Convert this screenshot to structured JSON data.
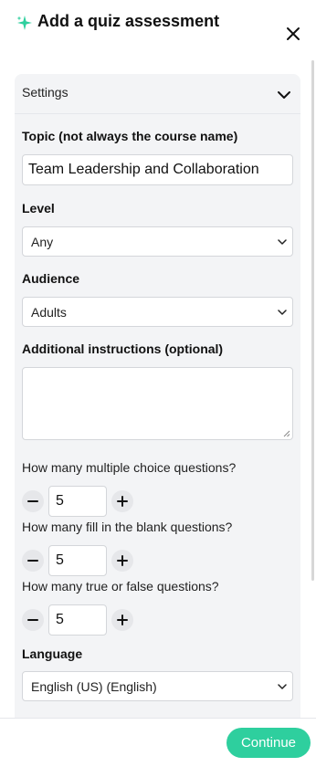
{
  "header": {
    "title": "Add a quiz assessment",
    "sparkle_icon": "sparkle-icon",
    "close_icon": "close-icon",
    "accent": "#2ecf9e"
  },
  "settings": {
    "label": "Settings",
    "expanded": true
  },
  "form": {
    "topic_label": "Topic (not always the course name)",
    "topic_value": "Team Leadership and Collaboration",
    "level_label": "Level",
    "level_value": "Any",
    "audience_label": "Audience",
    "audience_value": "Adults",
    "instructions_label": "Additional instructions (optional)",
    "instructions_value": "",
    "mc_label": "How many multiple choice questions?",
    "mc_value": "5",
    "fib_label": "How many fill in the blank questions?",
    "fib_value": "5",
    "tf_label": "How many true or false questions?",
    "tf_value": "5",
    "language_label": "Language",
    "language_value": "English (US) (English)"
  },
  "footer": {
    "continue_label": "Continue"
  }
}
